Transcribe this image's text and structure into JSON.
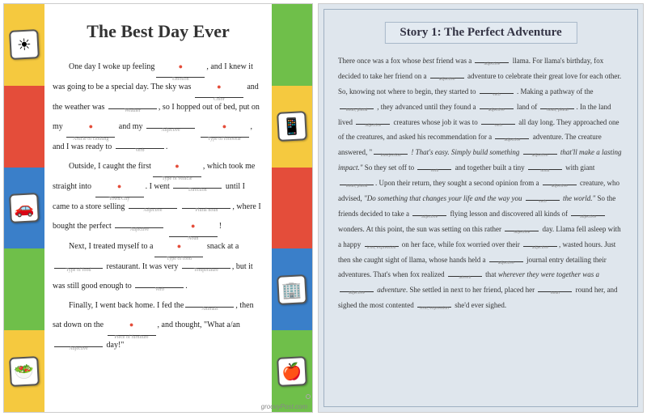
{
  "left": {
    "title": "The Best Day Ever",
    "attribution": "groovyPost.com",
    "story": {
      "l1a": "One day I woke up feeling ",
      "l1b": ", and I knew",
      "l2a": "it was going to be a special day. The sky was ",
      "l3a": "and the weather was ",
      "l3b": ", so I hopped out of",
      "l4a": "bed, put on my ",
      "l4b": " and my ",
      "l5a": ", and I was ready to ",
      "l5b": ".",
      "l6a": "Outside, I caught the first ",
      "l6b": ", which took",
      "l7a": "me straight into ",
      "l7b": ". I went ",
      "l8a": "until I came to a store selling ",
      "l8b": " ",
      "l8c": ",",
      "l9a": "where I bought the perfect ",
      "l9b": " ",
      "l9c": "!",
      "l10a": "Next, I treated myself to a ",
      "l10b": " snack at a",
      "l11a": " restaurant. It was very ",
      "l11b": ",",
      "l12a": "but it was still good enough to ",
      "l12b": ".",
      "l13a": "Finally, I went back home. I fed the ",
      "l13b": ",",
      "l14a": "then sat down on the ",
      "l14b": ", and thought, \"What",
      "l15a": "a/an ",
      "l15b": " day!\""
    },
    "hints": {
      "emotion": "Emotion",
      "color": "Color",
      "weather": "Weather",
      "clothing": "Article of clothing",
      "adjective": "Adjective",
      "footwear": "Type of footwear",
      "verb": "Verb",
      "vehicle": "Type of vehicle",
      "town": "Town/City",
      "direction": "Direction",
      "plural": "Plural noun",
      "noun": "Noun",
      "food": "Type of food",
      "temp": "Temperature",
      "animals": "Animals",
      "furniture": "Piece of furniture"
    },
    "stickers": [
      "☀",
      "🚗",
      "🥗",
      "📱",
      "🏢",
      "🍎"
    ]
  },
  "right": {
    "title": "Story 1: The Perfect Adventure",
    "story": {
      "p1a": "There once was a fox whose ",
      "p1em": "best",
      "p1b": " friend was a ",
      "p1c": " llama. For llama's",
      "p2a": "birthday, fox decided to take her friend on a ",
      "p2b": " adventure to",
      "p3a": "celebrate their great love for each other. So, knowing not where to begin,",
      "p4a": "they started to ",
      "p4b": " . Making a pathway of the ",
      "p4c": " , they",
      "p5a": " advanced until they found a ",
      "p5b": " land of ",
      "p5c": ". In the land lived",
      "p6a": " creatures whose job it was to ",
      "p6b": " all day long.",
      "p7a": "They approached one of the creatures, and asked his recommendation for a",
      "p8a": " adventure. The creature answered, \"",
      "p8b": " ! That's easy.",
      "p9a": "Simply build something ",
      "p9b": " that'll make a lasting impact.\"",
      "p9c": " So they set",
      "p10a": "off to ",
      "p10b": " and together built a tiny ",
      "p10c": " with giant ",
      "p10d": ".",
      "p11a": "Upon their return, they sought a second opinion from a ",
      "p11b": " creature,",
      "p12a": "who advised, ",
      "p12em": "\"Do something that changes your life and the way you ",
      "p12b": "",
      "p13a": "the world.\"",
      "p13b": " So the friends decided to take a ",
      "p13c": " flying lesson",
      "p14a": "and discovered all kinds of ",
      "p14b": " wonders.",
      "p15a": "At this point, the sun was setting on this rather ",
      "p15b": " day. Llama fell",
      "p16a": "asleep with a happy ",
      "p16b": " on her face, while fox worried over their",
      "p17a": ", wasted hours. Just then she caught sight of llama, whose hands",
      "p18a": "held a ",
      "p18b": " journal entry detailing their adventures. That's when",
      "p19a": "fox realized ",
      "p19b": " that ",
      "p19em": "wherever they were together was a ",
      "p20a": "adventure",
      "p20b": ". She settled in next to her friend, placed her ",
      "p20c": " round",
      "p21a": "her, and sighed the most contented ",
      "p21b": " she'd ever sighed."
    },
    "hints": {
      "adjective": "adjective",
      "verb": "verb",
      "nounpl": "noun, plural",
      "noun": "noun",
      "interjection": "interjection",
      "adverb": "adverb",
      "iconexpr": "icon, expression"
    }
  }
}
